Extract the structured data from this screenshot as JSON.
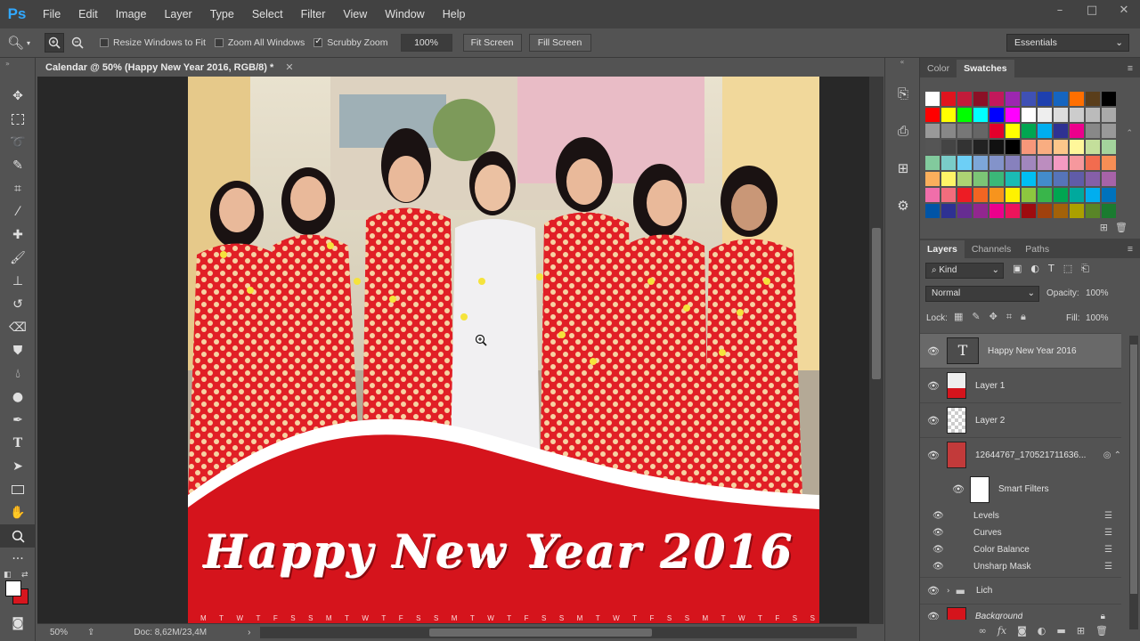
{
  "menubar": {
    "logo": "Ps",
    "items": [
      "File",
      "Edit",
      "Image",
      "Layer",
      "Type",
      "Select",
      "Filter",
      "View",
      "Window",
      "Help"
    ]
  },
  "options": {
    "resize_windows": "Resize Windows to Fit",
    "zoom_all": "Zoom All Windows",
    "scrubby_zoom": "Scrubby Zoom",
    "zoom_value": "100%",
    "fit_screen": "Fit Screen",
    "fill_screen": "Fill Screen",
    "workspace": "Essentials"
  },
  "document": {
    "tab_title": "Calendar @ 50% (Happy New Year 2016, RGB/8) *",
    "banner_text": "Happy New Year 2016",
    "weekday_letters": [
      "M",
      "T",
      "W",
      "T",
      "F",
      "S",
      "S",
      "M",
      "T",
      "W",
      "T",
      "F",
      "S",
      "S",
      "M",
      "T",
      "W",
      "T",
      "F",
      "S",
      "S",
      "M",
      "T",
      "W",
      "T",
      "F",
      "S",
      "S",
      "M",
      "T",
      "W",
      "T",
      "F",
      "S",
      "S"
    ]
  },
  "status": {
    "zoom": "50%",
    "doc_size": "Doc: 8,62M/23,4M"
  },
  "color_panel": {
    "tabs": [
      "Color",
      "Swatches"
    ],
    "active_tab": "Swatches",
    "swatches": [
      "#ffffff",
      "#e0141e",
      "#c21b3a",
      "#8b1026",
      "#c2185b",
      "#9c27b0",
      "#3f51b5",
      "#1e40af",
      "#1565c0",
      "#ff6f00",
      "#5a3e1b",
      "#000000",
      "#ff0000",
      "#ffff00",
      "#00ff00",
      "#00ffff",
      "#0000ff",
      "#ff00ff",
      "#ffffff",
      "#eeeeee",
      "#dddddd",
      "#cccccc",
      "#bbbbbb",
      "#aaaaaa",
      "#999999",
      "#888888",
      "#777777",
      "#666666",
      "#e4002b",
      "#ffff00",
      "#00a651",
      "#00aeef",
      "#2e3192",
      "#ec008c",
      "#888888",
      "#999999",
      "#555555",
      "#444444",
      "#333333",
      "#222222",
      "#111111",
      "#000000",
      "#f7977a",
      "#f9ad81",
      "#fdc68a",
      "#fff79a",
      "#c4df9b",
      "#a3d39c",
      "#82ca9d",
      "#7accc8",
      "#6dcff6",
      "#7da7d9",
      "#8393ca",
      "#8781bd",
      "#a187be",
      "#bc8dbf",
      "#f49ac2",
      "#f6989d",
      "#f26c4f",
      "#f68e55",
      "#fbaf5c",
      "#fff467",
      "#acd373",
      "#7cc576",
      "#3bb878",
      "#1abbb4",
      "#00bff3",
      "#438ccb",
      "#5674b9",
      "#605ca8",
      "#855fa8",
      "#a763a8",
      "#f06eaa",
      "#f26d7d",
      "#ed1c24",
      "#f26522",
      "#f7941d",
      "#fff200",
      "#8dc73f",
      "#39b54a",
      "#00a651",
      "#00a99d",
      "#00aeef",
      "#0072bc",
      "#0054a6",
      "#2e3192",
      "#662d91",
      "#92278f",
      "#ec008c",
      "#ed145b",
      "#9e0b0f",
      "#a0410d",
      "#a36209",
      "#aba000",
      "#598527",
      "#1a7b30"
    ]
  },
  "layers_panel": {
    "tabs": [
      "Layers",
      "Channels",
      "Paths"
    ],
    "active_tab": "Layers",
    "filter_kind": "Kind",
    "blend_mode": "Normal",
    "opacity_label": "Opacity:",
    "opacity": "100%",
    "lock_label": "Lock:",
    "fill_label": "Fill:",
    "fill": "100%",
    "layers": [
      {
        "name": "Happy New Year 2016",
        "type": "text"
      },
      {
        "name": "Layer 1",
        "type": "red"
      },
      {
        "name": "Layer 2",
        "type": "empty"
      },
      {
        "name": "12644767_170521711636...",
        "type": "smart"
      }
    ],
    "smart_filters_label": "Smart Filters",
    "filters": [
      "Levels",
      "Curves",
      "Color Balance",
      "Unsharp Mask"
    ],
    "group_name": "Lich",
    "background_name": "Background"
  }
}
